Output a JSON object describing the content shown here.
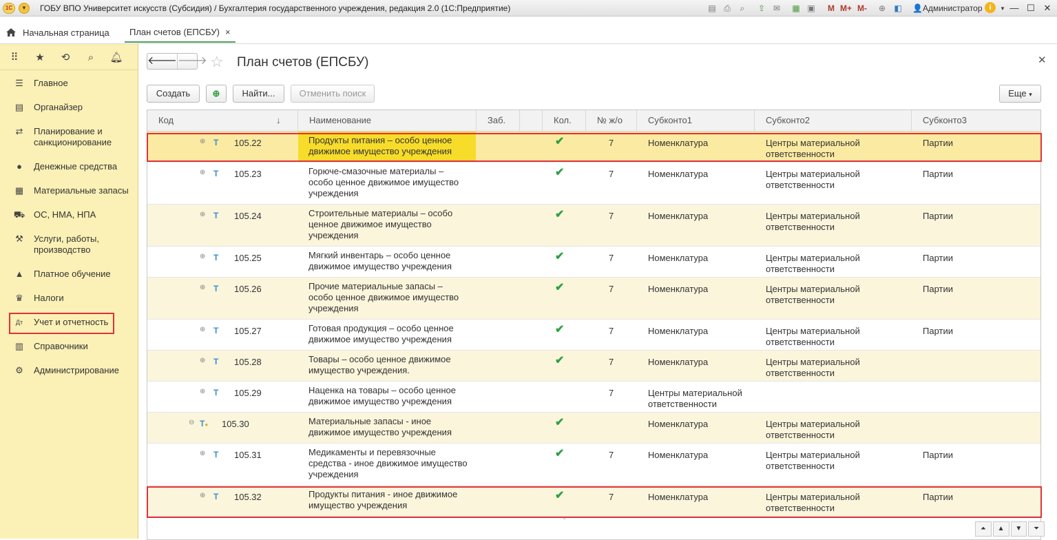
{
  "window": {
    "title": "ГОБУ ВПО Университет искусств (Субсидия) / Бухгалтерия государственного учреждения, редакция 2.0  (1С:Предприятие)",
    "logo": "1C",
    "user": "Администратор",
    "m_buttons": [
      "M",
      "M+",
      "M-"
    ]
  },
  "tabs": {
    "home": "Начальная страница",
    "doc": "План счетов (ЕПСБУ)",
    "close": "×"
  },
  "sidebar": {
    "items": [
      {
        "label": "Главное",
        "icon": "menu-icon"
      },
      {
        "label": "Органайзер",
        "icon": "organizer-icon"
      },
      {
        "label": "Планирование и санкционирование",
        "icon": "planning-icon"
      },
      {
        "label": "Денежные средства",
        "icon": "money-icon"
      },
      {
        "label": "Материальные запасы",
        "icon": "inventory-icon"
      },
      {
        "label": "ОС, НМА, НПА",
        "icon": "truck-icon"
      },
      {
        "label": "Услуги, работы, производство",
        "icon": "services-icon"
      },
      {
        "label": "Платное обучение",
        "icon": "education-icon"
      },
      {
        "label": "Налоги",
        "icon": "taxes-icon"
      },
      {
        "label": "Учет и отчетность",
        "icon": "accounting-icon"
      },
      {
        "label": "Справочники",
        "icon": "catalogs-icon"
      },
      {
        "label": "Администрирование",
        "icon": "gear-icon"
      }
    ]
  },
  "form": {
    "title": "План счетов (ЕПСБУ)",
    "buttons": {
      "create": "Создать",
      "find": "Найти...",
      "cancel_search": "Отменить поиск",
      "more": "Еще"
    }
  },
  "grid": {
    "columns": [
      "Код",
      "Наименование",
      "Заб.",
      "Кол.",
      "№ ж/о",
      "Субконто1",
      "Субконто2",
      "Субконто3"
    ],
    "sort_indicator": "↓",
    "rows": [
      {
        "code": "105.22",
        "name": "Продукты питания – особо ценное движимое имущество учреждения",
        "qty": true,
        "jo": "7",
        "s1": "Номенклатура",
        "s2": "Центры материальной ответственности",
        "s3": "Партии"
      },
      {
        "code": "105.23",
        "name": "Горюче-смазочные материалы – особо ценное движимое имущество учреждения",
        "qty": true,
        "jo": "7",
        "s1": "Номенклатура",
        "s2": "Центры материальной ответственности",
        "s3": "Партии"
      },
      {
        "code": "105.24",
        "name": "Строительные материалы – особо ценное движимое имущество учреждения",
        "qty": true,
        "jo": "7",
        "s1": "Номенклатура",
        "s2": "Центры материальной ответственности",
        "s3": "Партии"
      },
      {
        "code": "105.25",
        "name": "Мягкий инвентарь – особо ценное движимое имущество учреждения",
        "qty": true,
        "jo": "7",
        "s1": "Номенклатура",
        "s2": "Центры материальной ответственности",
        "s3": "Партии"
      },
      {
        "code": "105.26",
        "name": "Прочие материальные запасы – особо ценное движимое имущество учреждения",
        "qty": true,
        "jo": "7",
        "s1": "Номенклатура",
        "s2": "Центры материальной ответственности",
        "s3": "Партии"
      },
      {
        "code": "105.27",
        "name": "Готовая продукция – особо ценное движимое имущество учреждения",
        "qty": true,
        "jo": "7",
        "s1": "Номенклатура",
        "s2": "Центры материальной ответственности",
        "s3": "Партии"
      },
      {
        "code": "105.28",
        "name": "Товары –  особо ценное движимое имущество учреждения.",
        "qty": true,
        "jo": "7",
        "s1": "Номенклатура",
        "s2": "Центры материальной ответственности",
        "s3": ""
      },
      {
        "code": "105.29",
        "name": "Наценка на товары – особо ценное движимое имущество учреждения",
        "qty": false,
        "jo": "7",
        "s1": "Центры материальной ответственности",
        "s2": "",
        "s3": ""
      },
      {
        "code": "105.30",
        "name": "Материальные запасы - иное движимое имущество учреждения",
        "qty": true,
        "jo": "",
        "s1": "Номенклатура",
        "s2": "Центры материальной ответственности",
        "s3": ""
      },
      {
        "code": "105.31",
        "name": "Медикаменты и перевязочные средства - иное движимое имущество учреждения",
        "qty": true,
        "jo": "7",
        "s1": "Номенклатура",
        "s2": "Центры материальной ответственности",
        "s3": "Партии"
      },
      {
        "code": "105.32",
        "name": "Продукты питания - иное движимое имущество учреждения",
        "qty": true,
        "jo": "7",
        "s1": "Номенклатура",
        "s2": "Центры материальной ответственности",
        "s3": "Партии"
      }
    ]
  }
}
